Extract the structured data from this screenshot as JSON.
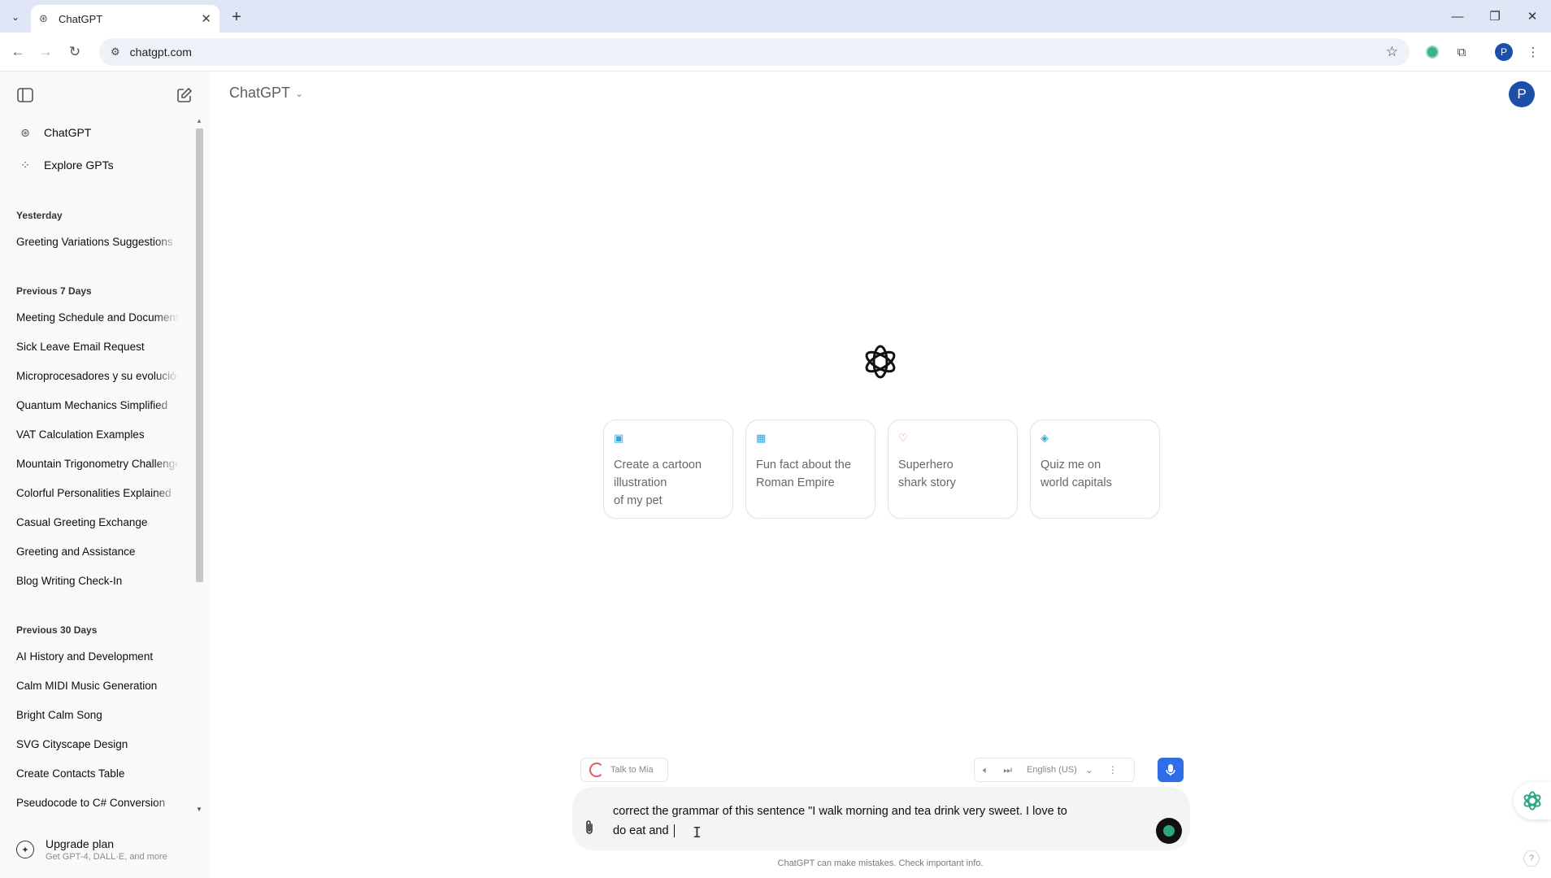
{
  "browser": {
    "tab_title": "ChatGPT",
    "url": "chatgpt.com",
    "profile_initial": "P"
  },
  "sidebar": {
    "nav": [
      {
        "label": "ChatGPT",
        "icon": "openai-icon"
      },
      {
        "label": "Explore GPTs",
        "icon": "grid-icon"
      }
    ],
    "sections": [
      {
        "title": "Yesterday",
        "items": [
          "Greeting Variations Suggestions"
        ]
      },
      {
        "title": "Previous 7 Days",
        "items": [
          "Meeting Schedule and Documents",
          "Sick Leave Email Request",
          "Microprocesadores y su evolución",
          "Quantum Mechanics Simplified",
          "VAT Calculation Examples",
          "Mountain Trigonometry Challenge",
          "Colorful Personalities Explained",
          "Casual Greeting Exchange",
          "Greeting and Assistance",
          "Blog Writing Check-In"
        ]
      },
      {
        "title": "Previous 30 Days",
        "items": [
          "AI History and Development",
          "Calm MIDI Music Generation",
          "Bright Calm Song",
          "SVG Cityscape Design",
          "Create Contacts Table",
          "Pseudocode to C# Conversion"
        ]
      }
    ],
    "upgrade": {
      "title": "Upgrade plan",
      "subtitle": "Get GPT-4, DALL·E, and more"
    }
  },
  "header": {
    "model_label": "ChatGPT",
    "avatar_initial": "P"
  },
  "suggestions": [
    {
      "lines": [
        "Create a cartoon",
        "illustration",
        "of my pet"
      ],
      "icon": "image-icon",
      "color": "#35a6d8"
    },
    {
      "lines": [
        "Fun fact about the",
        "Roman Empire"
      ],
      "icon": "calendar-icon",
      "color": "#35a6d8"
    },
    {
      "lines": [
        "Superhero",
        "shark story"
      ],
      "icon": "heart-icon",
      "color": "#c882c8"
    },
    {
      "lines": [
        "Quiz me on",
        "world capitals"
      ],
      "icon": "graduation-cap-icon",
      "color": "#35a6d8"
    }
  ],
  "voice_bar": {
    "talk_label": "Talk to Mia",
    "language": "English (US)"
  },
  "composer": {
    "text_line1": "correct the grammar of this sentence \"I walk morning and tea drink very sweet. I love to",
    "text_line2": "do eat and "
  },
  "disclaimer": "ChatGPT can make mistakes. Check important info.",
  "help_label": "?",
  "colors": {
    "accent_blue": "#2f6ee6",
    "avatar_blue": "#1d4fa8",
    "send_green": "#2ba783"
  }
}
